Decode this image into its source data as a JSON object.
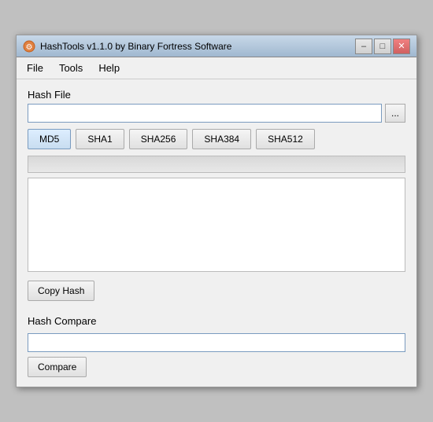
{
  "window": {
    "title": "HashTools v1.1.0 by Binary Fortress Software",
    "icon": "🔑"
  },
  "title_buttons": {
    "minimize": "–",
    "maximize": "□",
    "close": "✕"
  },
  "menu": {
    "items": [
      {
        "label": "File"
      },
      {
        "label": "Tools"
      },
      {
        "label": "Help"
      }
    ]
  },
  "hash_file_section": {
    "label": "Hash File",
    "file_input_placeholder": "",
    "browse_button_label": "..."
  },
  "hash_buttons": [
    {
      "label": "MD5",
      "active": true
    },
    {
      "label": "SHA1",
      "active": false
    },
    {
      "label": "SHA256",
      "active": false
    },
    {
      "label": "SHA384",
      "active": false
    },
    {
      "label": "SHA512",
      "active": false
    }
  ],
  "hash_output": {
    "value": ""
  },
  "copy_hash_button": {
    "label": "Copy Hash"
  },
  "hash_compare_section": {
    "label": "Hash Compare",
    "input_placeholder": "",
    "compare_button_label": "Compare"
  }
}
